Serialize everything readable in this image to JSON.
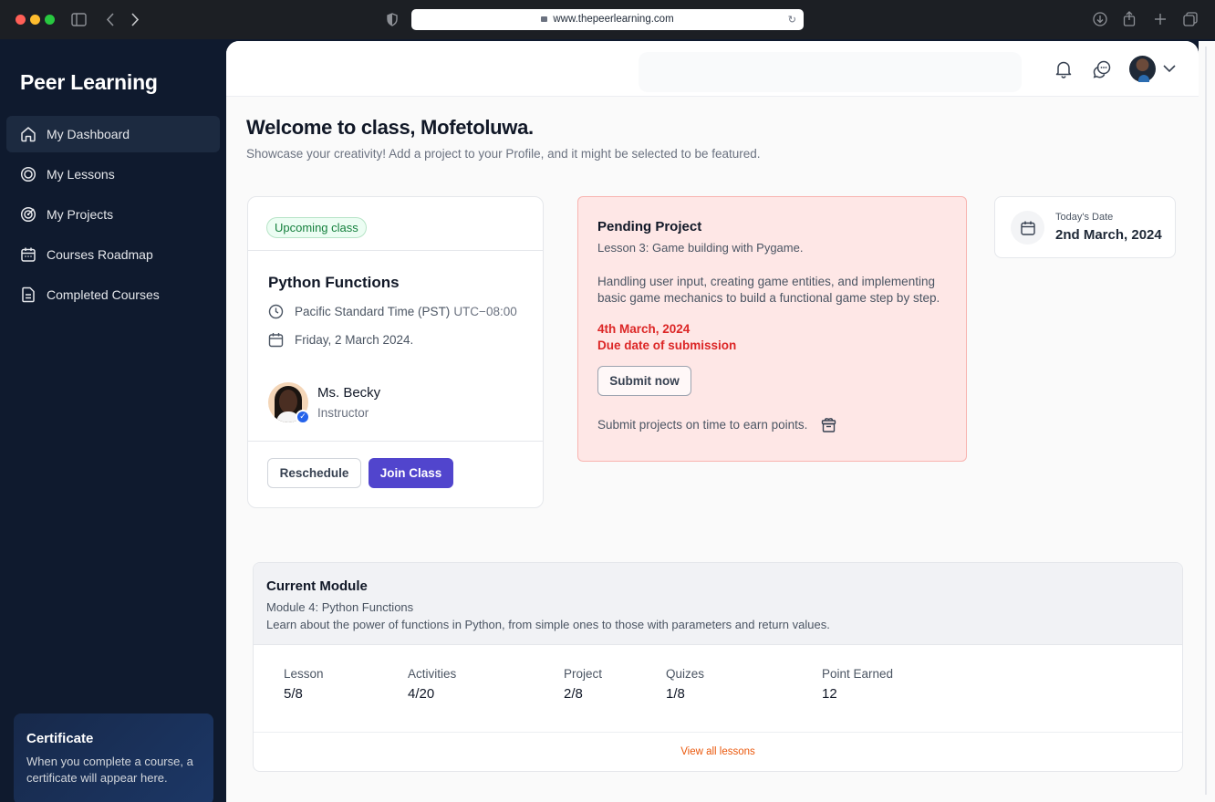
{
  "browser": {
    "url": "www.thepeerlearning.com"
  },
  "sidebar": {
    "logo": "Peer Learning",
    "items": [
      {
        "label": "My Dashboard",
        "icon": "home-icon",
        "active": true
      },
      {
        "label": "My Lessons",
        "icon": "target-icon",
        "active": false
      },
      {
        "label": "My Projects",
        "icon": "goal-icon",
        "active": false
      },
      {
        "label": "Courses Roadmap",
        "icon": "calendar-icon",
        "active": false
      },
      {
        "label": "Completed Courses",
        "icon": "document-icon",
        "active": false
      }
    ],
    "certificate": {
      "title": "Certificate",
      "text": "When you complete a course, a certificate will appear here."
    }
  },
  "header": {
    "icons": [
      "bell-icon",
      "chat-icon",
      "avatar",
      "chevron-down-icon"
    ]
  },
  "welcome": {
    "title": "Welcome to class, Mofetoluwa.",
    "subtitle": "Showcase your creativity! Add a project to your Profile, and it might be selected to be featured."
  },
  "upcoming_class": {
    "badge": "Upcoming class",
    "title": "Python Functions",
    "timezone": "Pacific Standard Time (PST)",
    "utc_offset": "UTC−08:00",
    "date": "Friday, 2 March 2024.",
    "instructor_name": "Ms. Becky",
    "instructor_role": "Instructor",
    "reschedule_label": "Reschedule",
    "join_label": "Join Class"
  },
  "pending_project": {
    "title": "Pending Project",
    "lesson": "Lesson 3: Game building with Pygame.",
    "description": "Handling user input, creating game entities, and implementing basic game mechanics to build a functional game step by step.",
    "due_date": "4th March, 2024",
    "due_label": "Due date of submission",
    "submit_label": "Submit now",
    "note": "Submit projects on time to earn points."
  },
  "today": {
    "label": "Today's Date",
    "value": "2nd March, 2024"
  },
  "current_module": {
    "title": "Current Module",
    "module": "Module 4: Python Functions",
    "description": "Learn about the power of functions in Python, from simple ones to those with parameters and return values.",
    "stats": [
      {
        "label": "Lesson",
        "value": "5/8"
      },
      {
        "label": "Activities",
        "value": "4/20"
      },
      {
        "label": "Project",
        "value": "2/8"
      },
      {
        "label": "Quizes",
        "value": "1/8"
      },
      {
        "label": "Point Earned",
        "value": "12"
      }
    ],
    "view_all": "View all lessons"
  },
  "colors": {
    "sidebar_bg": "#0f1a2e",
    "primary": "#5145cd",
    "danger": "#dc2626",
    "accent_link": "#ea580c",
    "badge_green": "#15803d"
  }
}
